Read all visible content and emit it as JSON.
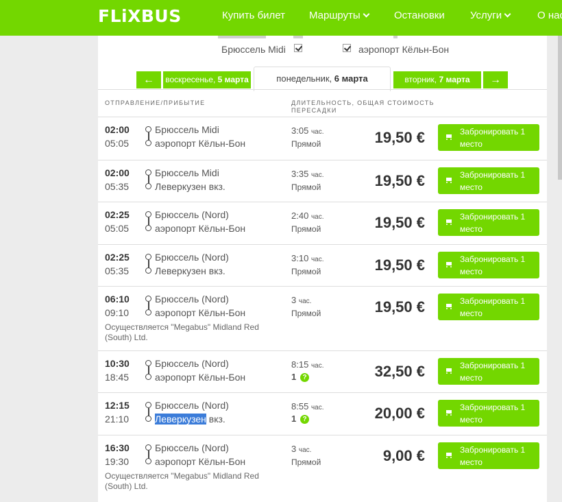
{
  "header": {
    "logo": "FLiXBUS",
    "nav": [
      {
        "label": "Купить билет",
        "dropdown": false
      },
      {
        "label": "Маршруты",
        "dropdown": true
      },
      {
        "label": "Остановки",
        "dropdown": false
      },
      {
        "label": "Услуги",
        "dropdown": true
      },
      {
        "label": "О нас",
        "dropdown": false
      }
    ]
  },
  "filters": {
    "departure_station": "Брюссель Midi",
    "departure_checked": true,
    "arrival_station": "аэропорт Кёльн-Бон",
    "arrival_checked": true
  },
  "dates": {
    "prev_arrow": "←",
    "next_arrow": "→",
    "prev_day": {
      "weekday": "воскресенье, ",
      "date": "5 марта"
    },
    "current_day": {
      "weekday": "понедельник, ",
      "date": "6 марта"
    },
    "next_day": {
      "weekday": "вторник, ",
      "date": "7 марта"
    }
  },
  "columns": {
    "departure_arrival": "ОТПРАВЛЕНИЕ/ПРИБЫТИЕ",
    "duration_price": "ДЛИТЕЛЬНОСТЬ, ОБЩАЯ СТОИМОСТЬ",
    "transfers": "ПЕРЕСАДКИ"
  },
  "book_label": "Забронировать 1 место",
  "hours_unit": "час.",
  "trips": [
    {
      "dep_time": "02:00",
      "arr_time": "05:05",
      "from": "Брюссель Midi",
      "to": "аэропорт Кёльн-Бон",
      "duration": "3:05",
      "transfer": "Прямой",
      "transfers_count": "",
      "price": "19,50 €",
      "operator": ""
    },
    {
      "dep_time": "02:00",
      "arr_time": "05:35",
      "from": "Брюссель Midi",
      "to": "Леверкузен вкз.",
      "duration": "3:35",
      "transfer": "Прямой",
      "transfers_count": "",
      "price": "19,50 €",
      "operator": ""
    },
    {
      "dep_time": "02:25",
      "arr_time": "05:05",
      "from": "Брюссель (Nord)",
      "to": "аэропорт Кёльн-Бон",
      "duration": "2:40",
      "transfer": "Прямой",
      "transfers_count": "",
      "price": "19,50 €",
      "operator": ""
    },
    {
      "dep_time": "02:25",
      "arr_time": "05:35",
      "from": "Брюссель (Nord)",
      "to": "Леверкузен вкз.",
      "duration": "3:10",
      "transfer": "Прямой",
      "transfers_count": "",
      "price": "19,50 €",
      "operator": ""
    },
    {
      "dep_time": "06:10",
      "arr_time": "09:10",
      "from": "Брюссель (Nord)",
      "to": "аэропорт Кёльн-Бон",
      "duration": "3",
      "transfer": "Прямой",
      "transfers_count": "",
      "price": "19,50 €",
      "operator": "Осуществляется \"Megabus\" Midland Red (South) Ltd."
    },
    {
      "dep_time": "10:30",
      "arr_time": "18:45",
      "from": "Брюссель (Nord)",
      "to": "аэропорт Кёльн-Бон",
      "duration": "8:15",
      "transfer": "",
      "transfers_count": "1",
      "price": "32,50 €",
      "operator": ""
    },
    {
      "dep_time": "12:15",
      "arr_time": "21:10",
      "from": "Брюссель (Nord)",
      "to_highlight": "Леверкузен",
      "to_rest": " вкз.",
      "duration": "8:55",
      "transfer": "",
      "transfers_count": "1",
      "price": "20,00 €",
      "operator": ""
    },
    {
      "dep_time": "16:30",
      "arr_time": "19:30",
      "from": "Брюссель (Nord)",
      "to": "аэропорт Кёльн-Бон",
      "duration": "3",
      "transfer": "Прямой",
      "transfers_count": "",
      "price": "9,00 €",
      "operator": "Осуществляется \"Megabus\" Midland Red (South) Ltd."
    }
  ]
}
